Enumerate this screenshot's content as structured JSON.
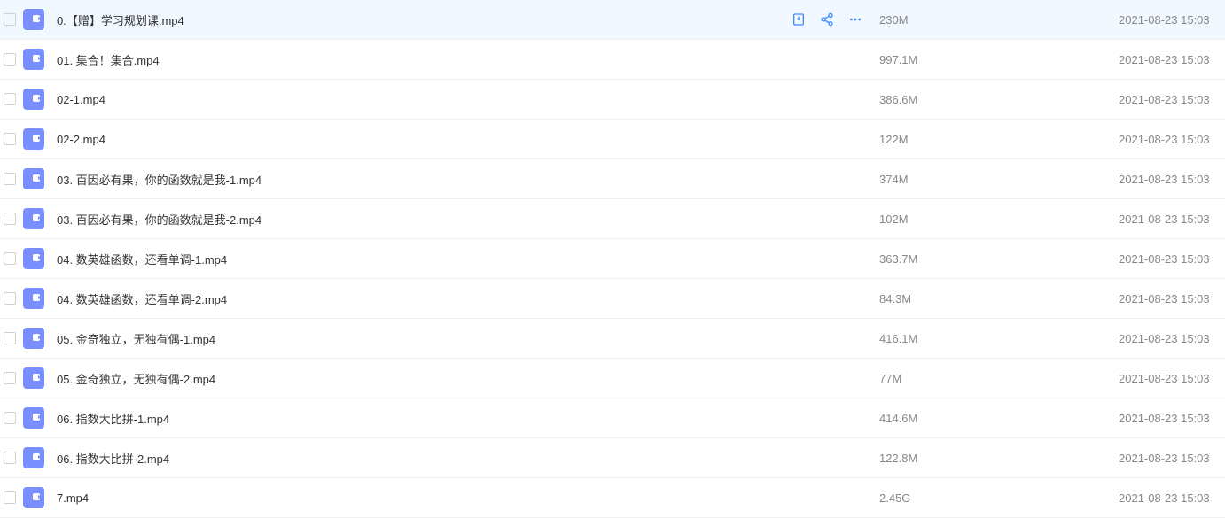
{
  "files": [
    {
      "name": "0.【赠】学习规划课.mp4",
      "size": "230M",
      "date": "2021-08-23 15:03"
    },
    {
      "name": "01. 集合！集合.mp4",
      "size": "997.1M",
      "date": "2021-08-23 15:03"
    },
    {
      "name": "02-1.mp4",
      "size": "386.6M",
      "date": "2021-08-23 15:03"
    },
    {
      "name": "02-2.mp4",
      "size": "122M",
      "date": "2021-08-23 15:03"
    },
    {
      "name": "03. 百因必有果，你的函数就是我-1.mp4",
      "size": "374M",
      "date": "2021-08-23 15:03"
    },
    {
      "name": "03. 百因必有果，你的函数就是我-2.mp4",
      "size": "102M",
      "date": "2021-08-23 15:03"
    },
    {
      "name": "04. 数英雄函数，还看单调-1.mp4",
      "size": "363.7M",
      "date": "2021-08-23 15:03"
    },
    {
      "name": "04. 数英雄函数，还看单调-2.mp4",
      "size": "84.3M",
      "date": "2021-08-23 15:03"
    },
    {
      "name": "05. 金奇独立，无独有偶-1.mp4",
      "size": "416.1M",
      "date": "2021-08-23 15:03"
    },
    {
      "name": "05. 金奇独立，无独有偶-2.mp4",
      "size": "77M",
      "date": "2021-08-23 15:03"
    },
    {
      "name": "06. 指数大比拼-1.mp4",
      "size": "414.6M",
      "date": "2021-08-23 15:03"
    },
    {
      "name": "06. 指数大比拼-2.mp4",
      "size": "122.8M",
      "date": "2021-08-23 15:03"
    },
    {
      "name": "7.mp4",
      "size": "2.45G",
      "date": "2021-08-23 15:03"
    }
  ]
}
